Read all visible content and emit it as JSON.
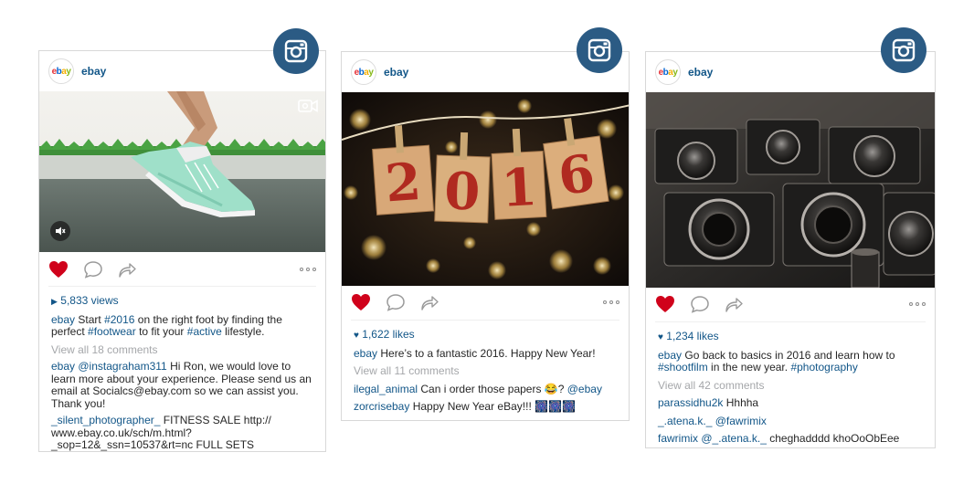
{
  "colors": {
    "badge": "#2b5b84",
    "link": "#125688",
    "heart": "#d0021b",
    "muted": "#a5a7aa"
  },
  "posts": [
    {
      "avatar_text": "ebay",
      "username": "ebay",
      "media": "video of a runner's foot in mint green sneakers on a green track",
      "stat_label": "5,833 views",
      "caption": {
        "user": "ebay",
        "parts": [
          "Start ",
          "#2016",
          " on the right foot by finding the perfect ",
          "#footwear",
          " to fit your ",
          "#active",
          " lifestyle."
        ]
      },
      "view_all": "View all 18 comments",
      "comments": [
        {
          "user": "ebay",
          "mention": "@instagraham311",
          "text": " Hi Ron, we would love to learn more about your experience. Please send us an email at Socialcs@ebay.com so we can assist you. Thank you!"
        },
        {
          "user": "_silent_photographer_",
          "text": " FITNESS SALE http:// www.ebay.co.uk/sch/m.html? _sop=12&_ssn=10537&rt=nc FULL SETS"
        }
      ]
    },
    {
      "avatar_text": "ebay",
      "username": "ebay",
      "media": "paper tags spelling 2016 hanging on a string with bokeh lights",
      "photo_digits": [
        "2",
        "0",
        "1",
        "6"
      ],
      "stat_label": "1,622 likes",
      "caption": {
        "user": "ebay",
        "text": " Here’s to a fantastic 2016. Happy New Year!"
      },
      "view_all": "View all 11 comments",
      "comments": [
        {
          "user": "ilegal_animal",
          "text": " Can i order those papers 😂? ",
          "mention": "@ebay"
        },
        {
          "user": "zorcrisebay",
          "text": " Happy New Year eBay!!! 🎆🎆🎆"
        }
      ]
    },
    {
      "avatar_text": "ebay",
      "username": "ebay",
      "media": "rows of vintage cameras in black and white",
      "stat_label": "1,234 likes",
      "caption": {
        "user": "ebay",
        "parts": [
          " Go back to basics in 2016 and learn how to ",
          "#shootfilm",
          " in the new year. ",
          "#photography"
        ]
      },
      "view_all": "View all 42 comments",
      "comments": [
        {
          "user": "parassidhu2k",
          "text": " Hhhha"
        },
        {
          "user": "_.atena.k._",
          "mention": " @fawrimix",
          "text": ""
        },
        {
          "user": "fawrimix",
          "mention": " @_.atena.k._",
          "text": " cheghadddd khoOoObEee"
        }
      ]
    }
  ]
}
